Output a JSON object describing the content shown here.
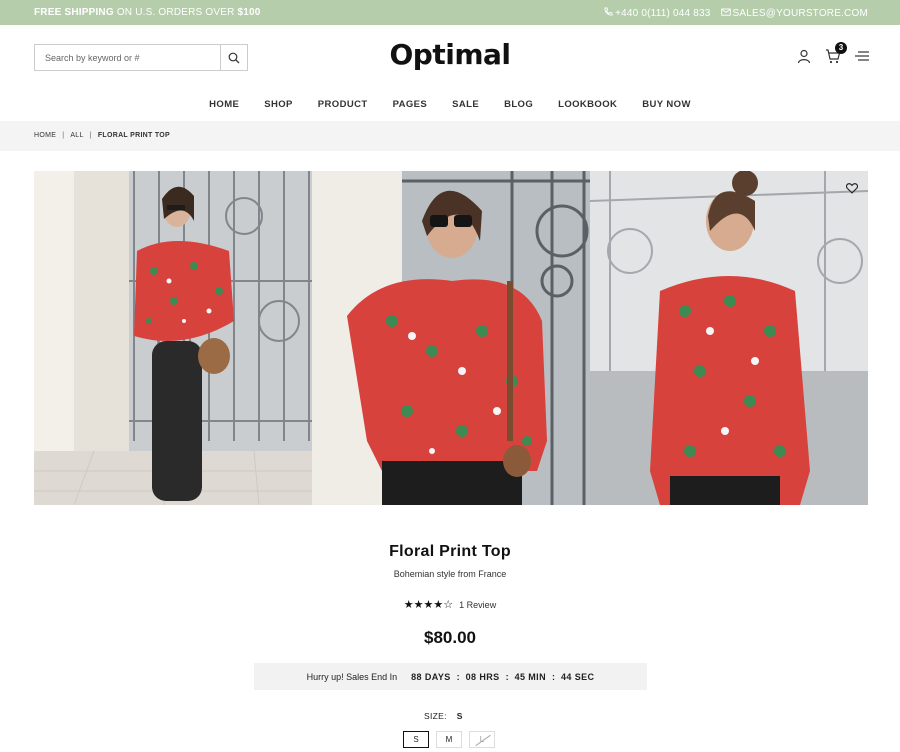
{
  "topbar": {
    "ship_strong": "FREE SHIPPING",
    "ship_text": " ON U.S. ORDERS OVER ",
    "ship_amount": "$100",
    "phone": "+440 0(111) 044 833",
    "email": "SALES@YOURSTORE.COM"
  },
  "search": {
    "placeholder": "Search by keyword or #"
  },
  "brand": "Optimal",
  "cart_count": "3",
  "nav": [
    "HOME",
    "SHOP",
    "PRODUCT",
    "PAGES",
    "SALE",
    "BLOG",
    "LOOKBOOK",
    "BUY NOW"
  ],
  "breadcrumb": {
    "home": "HOME",
    "all": "ALL",
    "current": "FLORAL PRINT TOP"
  },
  "product": {
    "title": "Floral Print Top",
    "subtitle": "Bohemian style from France",
    "rating": 4,
    "review_text": "1 Review",
    "price": "$80.00"
  },
  "countdown": {
    "label": "Hurry up! Sales End In",
    "days": "88 DAYS",
    "hours": "08 HRS",
    "mins": "45 MIN",
    "secs": "44 SEC",
    "sep": ":"
  },
  "size": {
    "label": "SIZE:",
    "selected": "S",
    "options": [
      "S",
      "M",
      "L"
    ]
  },
  "colors": {
    "topbar": "#b5cdab",
    "accent": "#111111"
  },
  "icons": [
    "phone-icon",
    "mail-icon",
    "search-icon",
    "user-icon",
    "cart-icon",
    "menu-icon",
    "heart-icon"
  ]
}
